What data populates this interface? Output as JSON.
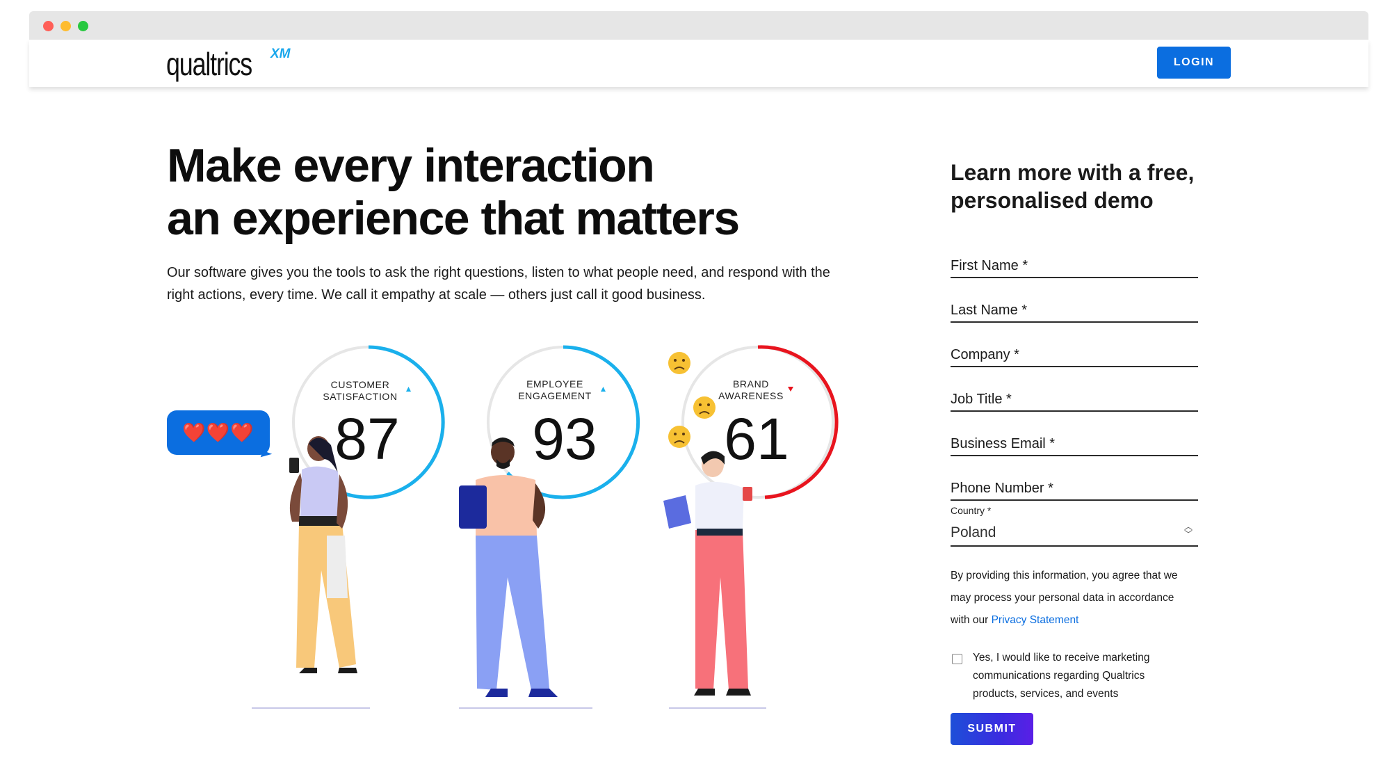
{
  "header": {
    "logo_text": "qualtrics",
    "logo_suffix": "XM",
    "login_label": "LOGIN"
  },
  "hero": {
    "title_line1": "Make every interaction",
    "title_line2": "an experience that matters",
    "body_line1": "Our software gives you the tools to ask the right questions, listen to what people need, and respond with the",
    "body_line2": "right actions, every time. We call it empathy at scale — others just call it good business."
  },
  "illustration": {
    "bubble_icons": "❤️❤️❤️",
    "gauges": [
      {
        "label_line1": "CUSTOMER",
        "label_line2": "SATISFACTION",
        "value": "87",
        "trend": "up",
        "color": "#1ab0ec"
      },
      {
        "label_line1": "EMPLOYEE",
        "label_line2": "ENGAGEMENT",
        "value": "93",
        "trend": "up",
        "color": "#1ab0ec"
      },
      {
        "label_line1": "BRAND",
        "label_line2": "AWARENESS",
        "value": "61",
        "trend": "down",
        "color": "#e8141e"
      }
    ]
  },
  "form": {
    "title_line1": "Learn more with a free,",
    "title_line2": "personalised demo",
    "fields": [
      "First Name *",
      "Last Name *",
      "Company *",
      "Job Title *",
      "Business Email *",
      "Phone Number *"
    ],
    "country_label": "Country *",
    "country_value": "Poland",
    "consent_line1": "By providing this information, you agree that we",
    "consent_line2": "may process your personal data in accordance",
    "consent_line3_prefix": "with our ",
    "privacy_link": "Privacy Statement",
    "marketing_line1": "Yes, I would like to receive marketing",
    "marketing_line2": "communications regarding Qualtrics",
    "marketing_line3": "products, services, and events",
    "submit_label": "SUBMIT"
  },
  "colors": {
    "primary_blue": "#0b6ee0",
    "gauge_blue": "#1ab0ec",
    "gauge_red": "#e8141e"
  }
}
